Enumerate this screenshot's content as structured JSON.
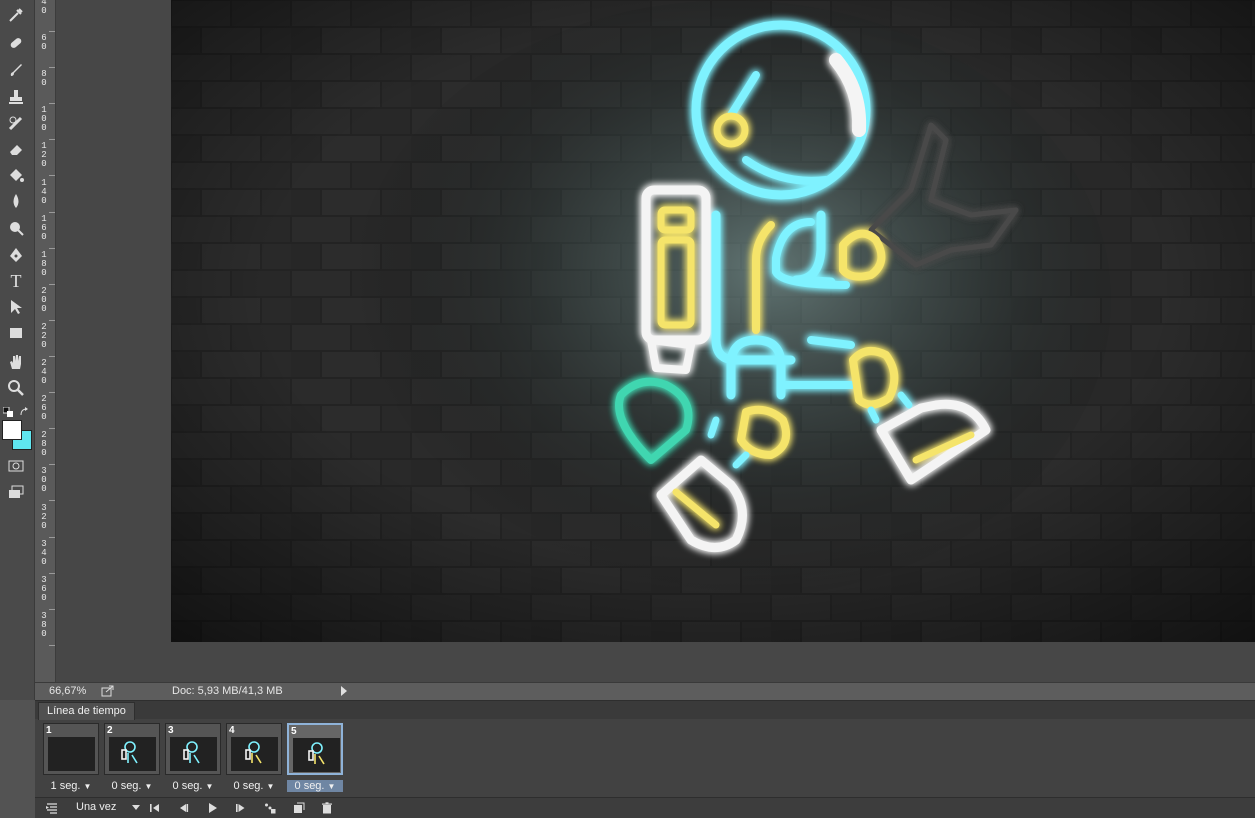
{
  "toolbar": {
    "tools": [
      {
        "name": "eyedropper-icon"
      },
      {
        "name": "healing-brush-icon"
      },
      {
        "name": "brush-icon"
      },
      {
        "name": "clone-stamp-icon"
      },
      {
        "name": "history-brush-icon"
      },
      {
        "name": "eraser-icon"
      },
      {
        "name": "paint-bucket-icon"
      },
      {
        "name": "blur-icon"
      },
      {
        "name": "dodge-icon"
      },
      {
        "name": "pen-icon"
      },
      {
        "name": "type-icon"
      },
      {
        "name": "path-selection-icon"
      },
      {
        "name": "rectangle-icon"
      },
      {
        "name": "hand-icon"
      },
      {
        "name": "zoom-icon"
      }
    ],
    "type_glyph": "T",
    "foreground_color": "#ffffff",
    "background_color": "#5fe6f0"
  },
  "ruler": {
    "labels": [
      "40",
      "60",
      "80",
      "100",
      "120",
      "140",
      "160",
      "180",
      "200",
      "220",
      "240",
      "260",
      "280",
      "300",
      "320",
      "340",
      "360",
      "380"
    ]
  },
  "status": {
    "zoom": "66,67%",
    "doc_info": "Doc: 5,93 MB/41,3 MB"
  },
  "timeline": {
    "tab_label": "Línea de tiempo",
    "frames": [
      {
        "number": "1",
        "delay": "1 seg.",
        "selected": false
      },
      {
        "number": "2",
        "delay": "0 seg.",
        "selected": false
      },
      {
        "number": "3",
        "delay": "0 seg.",
        "selected": false
      },
      {
        "number": "4",
        "delay": "0 seg.",
        "selected": false
      },
      {
        "number": "5",
        "delay": "0 seg.",
        "selected": true
      }
    ],
    "loop_option": "Una vez"
  },
  "artwork": {
    "neon_cyan": "#7ff2ff",
    "neon_yellow": "#f5e46a",
    "neon_white": "#f4f4f4",
    "neon_teal": "#3fd6b0",
    "wall_color": "#2e2e2e"
  }
}
